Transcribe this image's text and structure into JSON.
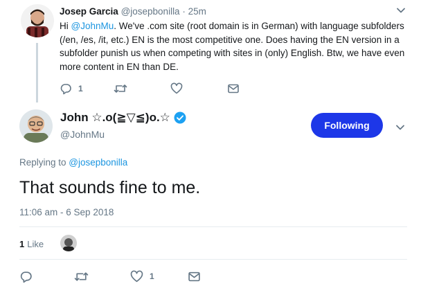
{
  "parent_tweet": {
    "name": "Josep Garcia",
    "handle": "@josepbonilla",
    "separator": "·",
    "time": "25m",
    "text_segments": [
      {
        "text": "Hi ",
        "mention": false
      },
      {
        "text": "@JohnMu",
        "mention": true
      },
      {
        "text": ". We've .com site (root domain is in German) with language subfolders (/en, /es, /it, etc.) EN is the most competitive one. Does having the EN version in a subfolder punish us when competing with sites in (only) English. Btw, we have even more content in EN than DE.",
        "mention": false
      }
    ],
    "actions": {
      "reply_icon": "reply-icon",
      "reply_count": "1",
      "retweet_icon": "retweet-icon",
      "like_icon": "heart-icon",
      "dm_icon": "envelope-icon"
    }
  },
  "main_tweet": {
    "name": "John ☆.o(≧▽≦)o.☆",
    "handle": "@JohnMu",
    "follow_button_label": "Following",
    "replying_prefix": "Replying to ",
    "replying_to": "@josepbonilla",
    "text": "That sounds fine to me.",
    "timestamp": "11:06 am - 6 Sep 2018",
    "likes_count": "1",
    "likes_label": "Like",
    "actions": {
      "reply_icon": "reply-icon",
      "retweet_icon": "retweet-icon",
      "like_icon": "heart-icon",
      "like_count": "1",
      "dm_icon": "envelope-icon"
    }
  },
  "colors": {
    "accent": "#1b95e0",
    "follow_button": "#1d37e8",
    "muted": "#657786",
    "thread_line": "#ccd6dd",
    "verified": "#1da1f2"
  }
}
